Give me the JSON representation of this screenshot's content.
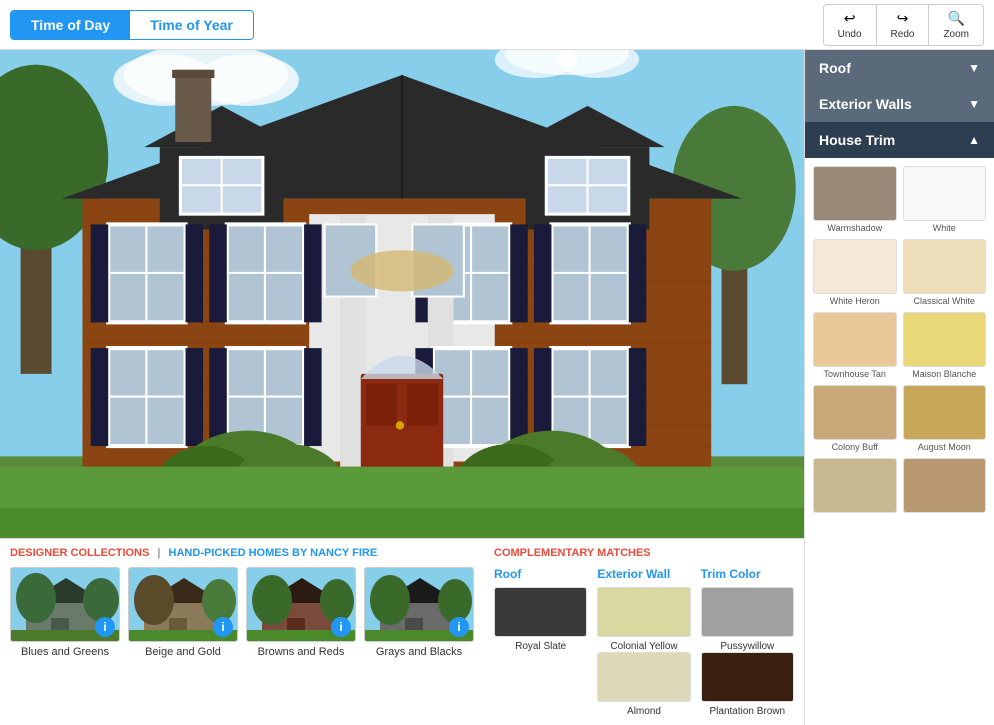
{
  "topBar": {
    "tabs": [
      {
        "id": "time-of-day",
        "label": "Time of Day",
        "active": true
      },
      {
        "id": "time-of-year",
        "label": "Time of Year",
        "active": false
      }
    ],
    "toolbar": [
      {
        "id": "undo",
        "icon": "↩",
        "label": "Undo"
      },
      {
        "id": "redo",
        "icon": "↪",
        "label": "Redo"
      },
      {
        "id": "zoom",
        "icon": "🔍",
        "label": "Zoom"
      }
    ]
  },
  "sidebar": {
    "sections": [
      {
        "id": "roof",
        "label": "Roof",
        "expanded": false
      },
      {
        "id": "exterior-walls",
        "label": "Exterior Walls",
        "expanded": false
      },
      {
        "id": "house-trim",
        "label": "House Trim",
        "expanded": true
      }
    ],
    "swatches": [
      {
        "id": "warmshadow",
        "color": "#9b8a78",
        "label": "Warmshadow"
      },
      {
        "id": "white",
        "color": "#f8f8f8",
        "label": "White"
      },
      {
        "id": "white-heron",
        "color": "#f5e8d8",
        "label": "White Heron"
      },
      {
        "id": "classical-white",
        "color": "#edddb8",
        "label": "Classical White"
      },
      {
        "id": "townhouse-tan",
        "color": "#e8c898",
        "label": "Townhouse Tan"
      },
      {
        "id": "maison-blanche",
        "color": "#e8d878",
        "label": "Maison Blanche"
      },
      {
        "id": "colony-buff",
        "color": "#c8a878",
        "label": "Colony Buff"
      },
      {
        "id": "august-moon",
        "color": "#c8a858",
        "label": "August Moon"
      },
      {
        "id": "swatch9",
        "color": "#c8b890",
        "label": ""
      },
      {
        "id": "swatch10",
        "color": "#b89870",
        "label": ""
      }
    ]
  },
  "designerSection": {
    "mainTitle": "DESIGNER COLLECTIONS",
    "separator": "|",
    "subTitle": "HAND-PICKED HOMES BY NANCY FIRE",
    "homes": [
      {
        "id": "blues-greens",
        "label": "Blues and Greens",
        "bgColor": "#7a8a6a"
      },
      {
        "id": "beige-gold",
        "label": "Beige and Gold",
        "bgColor": "#8a7a5a"
      },
      {
        "id": "browns-reds",
        "label": "Browns and Reds",
        "bgColor": "#7a5a4a"
      },
      {
        "id": "grays-blacks",
        "label": "Grays and Blacks",
        "bgColor": "#5a5a5a"
      }
    ]
  },
  "compSection": {
    "title": "COMPLEMENTARY MATCHES",
    "columns": [
      {
        "id": "roof",
        "title": "Roof",
        "swatches": [
          {
            "id": "royal-slate",
            "color": "#3a3a3a",
            "label": "Royal Slate"
          }
        ]
      },
      {
        "id": "exterior-wall",
        "title": "Exterior Wall",
        "swatches": [
          {
            "id": "colonial-yellow",
            "color": "#d8d8a0",
            "label": "Colonial Yellow"
          },
          {
            "id": "almond",
            "color": "#ddd8b8",
            "label": "Almond"
          }
        ]
      },
      {
        "id": "trim-color",
        "title": "Trim Color",
        "swatches": [
          {
            "id": "pussywillow",
            "color": "#a0a0a0",
            "label": "Pussywillow"
          },
          {
            "id": "plantation-brown",
            "color": "#3a2010",
            "label": "Plantation Brown"
          }
        ]
      }
    ]
  }
}
